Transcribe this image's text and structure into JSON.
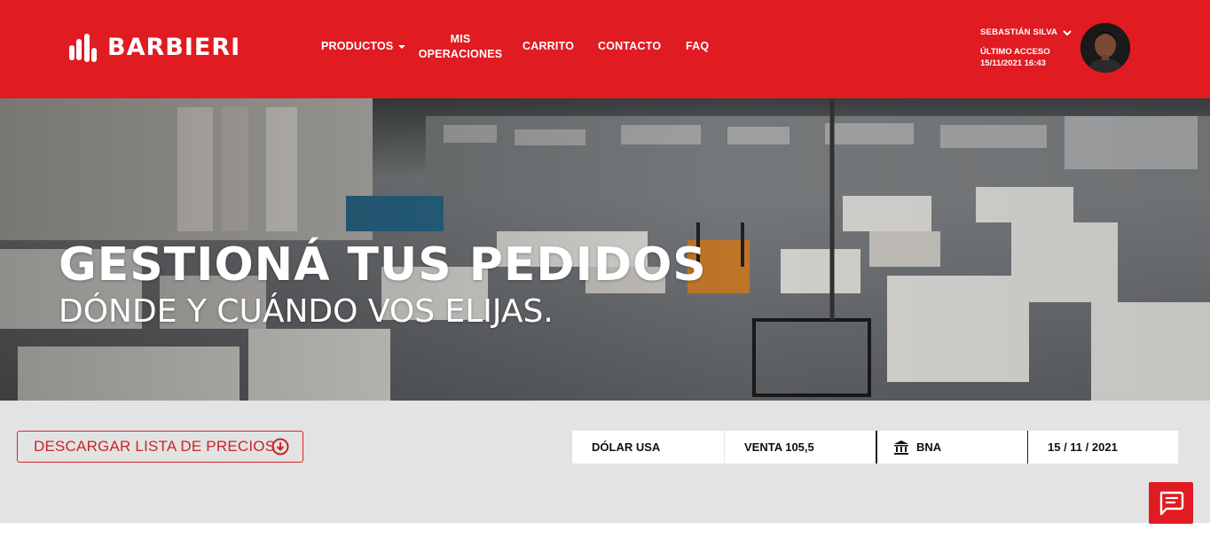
{
  "brand": {
    "name": "BARBIERI",
    "primary_color": "#e01b22",
    "logo_icon": "barbieri-bars-logo"
  },
  "nav": {
    "items": [
      {
        "label": "PRODUCTOS",
        "has_dropdown": true
      },
      {
        "label": "MIS OPERACIONES"
      },
      {
        "label": "CARRITO"
      },
      {
        "label": "CONTACTO"
      },
      {
        "label": "FAQ"
      }
    ]
  },
  "user": {
    "name": "SEBASTIÁN SILVA",
    "last_access_label": "ÚLTIMO ACCESO",
    "last_access_value": "15/11/2021 16:43",
    "menu_icon": "chevron-down-icon",
    "avatar_icon": "user-avatar"
  },
  "hero": {
    "title": "GESTIONÁ TUS PEDIDOS",
    "subtitle": "DÓNDE Y CUÁNDO VOS ELIJAS."
  },
  "downloads": {
    "price_list_label": "DESCARGAR LISTA DE PRECIOS",
    "icon": "download-circle-icon"
  },
  "exchange_rate": {
    "currency": "DÓLAR USA",
    "sale": "VENTA 105,5",
    "bank": "BNA",
    "bank_icon": "bank-icon",
    "date": "15 / 11 / 2021"
  },
  "chat": {
    "icon": "chat-icon"
  }
}
